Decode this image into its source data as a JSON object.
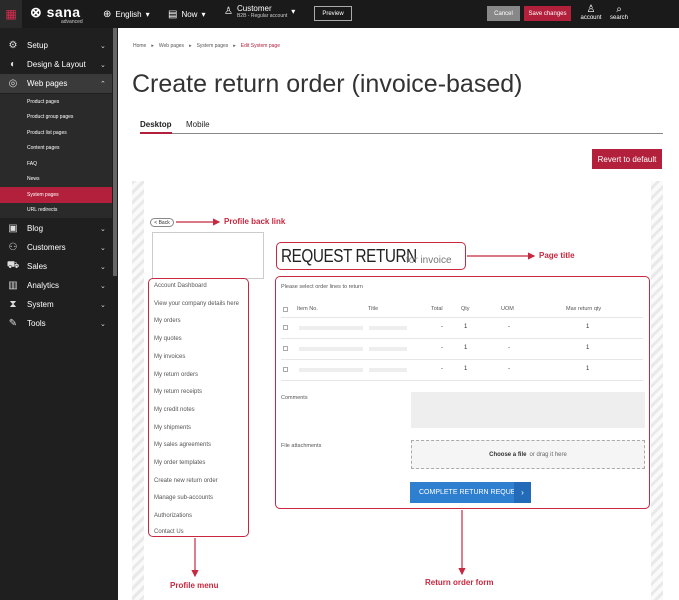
{
  "topbar": {
    "logo": "sana",
    "logo_sub": "advanced",
    "language": "English",
    "now": "Now",
    "customer_name": "Customer",
    "customer_sub": "B2B - Regular account",
    "preview": "Preview",
    "cancel": "Cancel",
    "save": "Save changes",
    "account": "account",
    "search": "search"
  },
  "sidebar": {
    "items": [
      {
        "icon": "gear-icon",
        "label": "Setup"
      },
      {
        "icon": "palette-icon",
        "label": "Design & Layout"
      },
      {
        "icon": "globe-icon",
        "label": "Web pages"
      },
      {
        "icon": "blog-icon",
        "label": "Blog"
      },
      {
        "icon": "customers-icon",
        "label": "Customers"
      },
      {
        "icon": "cart-icon",
        "label": "Sales"
      },
      {
        "icon": "analytics-icon",
        "label": "Analytics"
      },
      {
        "icon": "system-icon",
        "label": "System"
      },
      {
        "icon": "tools-icon",
        "label": "Tools"
      }
    ],
    "subitems": [
      "Product pages",
      "Product group pages",
      "Product list pages",
      "Content pages",
      "FAQ",
      "News",
      "System pages",
      "URL redirects"
    ]
  },
  "breadcrumb": [
    "Home",
    "Web pages",
    "System pages",
    "Edit System page"
  ],
  "page_title": "Create return order (invoice-based)",
  "tabs": [
    "Desktop",
    "Mobile"
  ],
  "revert": "Revert to default",
  "preview": {
    "back": "< Back",
    "menu": [
      "Account Dashboard",
      "View your company details here",
      "My orders",
      "My quotes",
      "My invoices",
      "My return orders",
      "My return receipts",
      "My credit notes",
      "My shipments",
      "My sales agreements",
      "My order templates",
      "Create new return order",
      "Manage sub-accounts",
      "Authorizations",
      "Contact Us"
    ],
    "title_main": "REQUEST RETURN",
    "title_sub": "for invoice",
    "select_text": "Please select order lines to return",
    "columns": [
      "Item No.",
      "Title",
      "Total",
      "Qty",
      "UOM",
      "Max return qty"
    ],
    "rows": [
      {
        "total": "-",
        "qty": "1",
        "uom": "-",
        "max": "1"
      },
      {
        "total": "-",
        "qty": "1",
        "uom": "-",
        "max": "1"
      },
      {
        "total": "-",
        "qty": "1",
        "uom": "-",
        "max": "1"
      }
    ],
    "comments": "Comments",
    "file_attachments": "File attachments",
    "choose_file": "Choose a file",
    "drag_text": "or drag it here",
    "submit": "COMPLETE RETURN REQUEST"
  },
  "annotations": {
    "profile_back_link": "Profile back link",
    "page_title": "Page title",
    "profile_menu": "Profile menu",
    "return_order_form": "Return order form"
  },
  "colors": {
    "accent": "#b3203c",
    "annotation": "#c8283f",
    "button_blue": "#2f7fd0"
  }
}
